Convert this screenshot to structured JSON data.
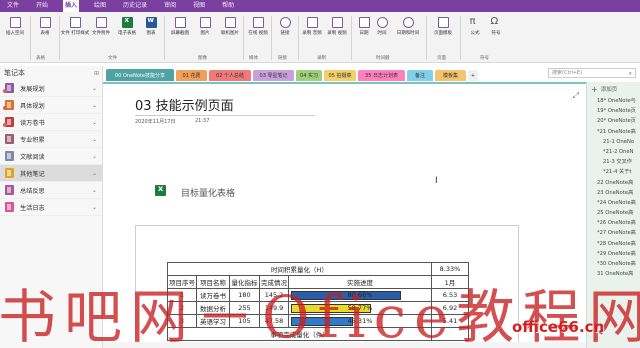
{
  "menu": {
    "items": [
      "文件",
      "开始",
      "插入",
      "绘图",
      "历史记录",
      "审阅",
      "视图",
      "帮助"
    ],
    "active_index": 2
  },
  "ribbon": {
    "buttons": [
      {
        "label": "插入空间",
        "icon": "insert-space-icon"
      },
      {
        "label": "表格",
        "icon": "table-icon"
      },
      {
        "label": "文件\n打印样式",
        "icon": "file-printout-icon"
      },
      {
        "label": "文件附件",
        "icon": "attachment-icon"
      },
      {
        "label": "电子表格",
        "icon": "spreadsheet-icon"
      },
      {
        "label": "图表",
        "icon": "diagram-icon"
      },
      {
        "label": "屏幕截图",
        "icon": "screenshot-icon"
      },
      {
        "label": "图片",
        "icon": "picture-icon"
      },
      {
        "label": "联机图片",
        "icon": "online-picture-icon"
      },
      {
        "label": "在线\n视频",
        "icon": "online-video-icon"
      },
      {
        "label": "链接",
        "icon": "link-icon"
      },
      {
        "label": "录制\n音频",
        "icon": "record-audio-icon"
      },
      {
        "label": "录制\n视频",
        "icon": "record-video-icon"
      },
      {
        "label": "日期",
        "icon": "date-icon"
      },
      {
        "label": "时间",
        "icon": "time-icon"
      },
      {
        "label": "日期和时间",
        "icon": "date-time-icon"
      },
      {
        "label": "页面模板",
        "icon": "page-template-icon"
      },
      {
        "label": "公式",
        "icon": "equation-icon"
      },
      {
        "label": "符号",
        "icon": "symbol-icon"
      }
    ],
    "groups": [
      "表格",
      "文件",
      "图像",
      "媒体",
      "链接",
      "录制",
      "时间戳",
      "页面",
      "符号"
    ]
  },
  "sidebar": {
    "title": "笔记本",
    "items": [
      {
        "label": "发展规划",
        "color": "#8a5aa8",
        "dot": true
      },
      {
        "label": "具体规划",
        "color": "#d9732e",
        "dot": true
      },
      {
        "label": "读万卷书",
        "color": "#c23b3b",
        "dot": true
      },
      {
        "label": "专业积累",
        "color": "#9b5f73",
        "dot": false
      },
      {
        "label": "文献阅读",
        "color": "#7d89a8",
        "dot": false
      },
      {
        "label": "其他笔记",
        "color": "#e2a32a",
        "dot": false,
        "selected": true
      },
      {
        "label": "总结反思",
        "color": "#a8579b",
        "dot": false
      },
      {
        "label": "生活日志",
        "color": "#d9568f",
        "dot": false
      }
    ]
  },
  "tabs": [
    {
      "label": "00 OneNote技能分享",
      "color": "#4fa3a3",
      "active": true
    },
    {
      "label": "01 花费",
      "color": "#f29f5c"
    },
    {
      "label": "02 个人总结",
      "color": "#f07a7a"
    },
    {
      "label": "03 零星笔记",
      "color": "#c9a0dc"
    },
    {
      "label": "04 实习",
      "color": "#9fcf7b"
    },
    {
      "label": "05 拍摄菜",
      "color": "#f2d16b"
    },
    {
      "label": "35 日志计划表",
      "color": "#ff7fbf"
    },
    {
      "label": "备注",
      "color": "#7fd0e8"
    },
    {
      "label": "模板集",
      "color": "#f5c36b"
    },
    {
      "label": "+",
      "color": "#f0f0f0"
    }
  ],
  "search": {
    "placeholder": "搜索(Ctrl+E)"
  },
  "page": {
    "title": "03 技能示例页面",
    "date": "2020年11月17日",
    "time": "21:37",
    "embed_title": "目标量化表格"
  },
  "table": {
    "banner": "时间积累量化（H）",
    "banner_pct": "8.33%",
    "headers": [
      "项目序号",
      "项目名称",
      "量化指标",
      "完成情况",
      "实施进度",
      "1月"
    ],
    "rows": [
      {
        "no": "1",
        "name": "读万卷书",
        "target": "180",
        "done": "145.2",
        "progress": "80.66%",
        "pct": 0.8066,
        "bar_color": "#2b5ea8",
        "m1": "6.53"
      },
      {
        "no": "2",
        "name": "数据分析",
        "target": "255",
        "done": "149.9",
        "progress": "58.77%",
        "pct": 0.5877,
        "bar_color": "#e8dc2a",
        "m1": "6.92"
      },
      {
        "no": "3",
        "name": "英语学习",
        "target": "105",
        "done": "47.58",
        "progress": "45.31%",
        "pct": 0.4531,
        "bar_color": "#2f7ac9",
        "m1": "5.41"
      }
    ],
    "footer": "事项完成量化（件）"
  },
  "right_pane": {
    "add_label": "添加页",
    "items": [
      "18* OneNote与",
      "19* OneNote页",
      "20* OneNote页",
      "*21 OneNote高",
      "21-1 OneNo",
      "*21-2 OneN",
      "21-3 交叉作",
      "*21-4 关于t",
      "22 OneNote高",
      "23 OneNote高",
      "*24 OneNote高",
      "25 OneNote高",
      "*26 OneNote高",
      "*27 OneNote高",
      "*28 OneNote高",
      "*29 OneNote高",
      "*30 OneNote高",
      "31 OneNote高"
    ]
  },
  "watermark": {
    "main": "书吧网－Ofice教程网",
    "site": "office66.cn"
  }
}
